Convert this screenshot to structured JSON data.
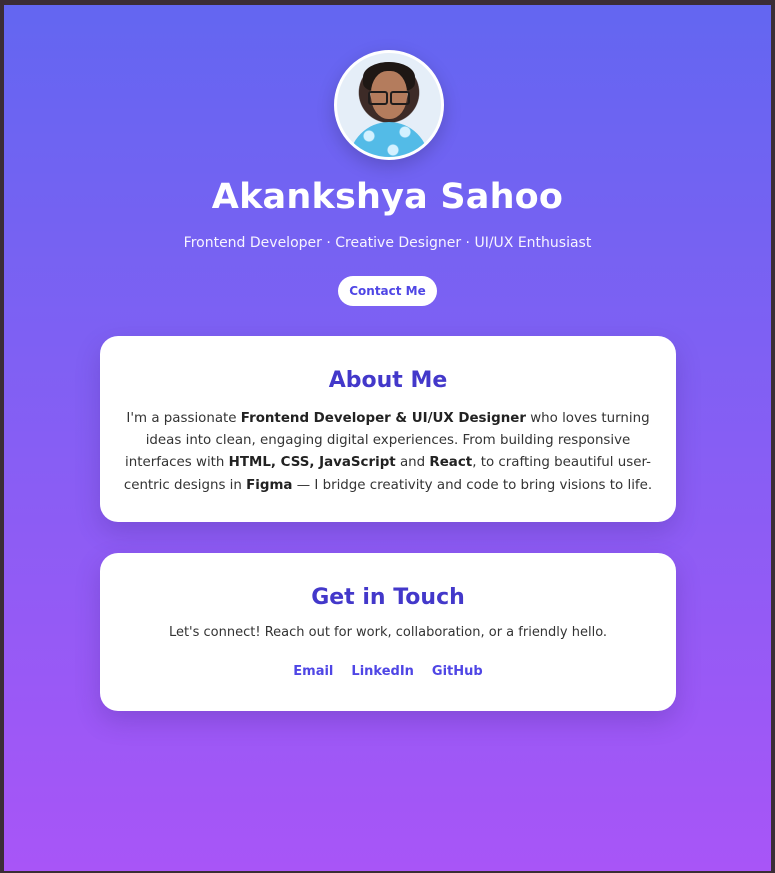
{
  "hero": {
    "name": "Akankshya Sahoo",
    "tagline": "Frontend Developer · Creative Designer · UI/UX Enthusiast",
    "contact_button": "Contact Me"
  },
  "about": {
    "title": "About Me",
    "text": {
      "part1": "I'm a passionate ",
      "highlight1": "Frontend Developer & UI/UX Designer",
      "part2": " who loves turning ideas into clean, engaging digital experiences. From building responsive interfaces with ",
      "highlight2": "HTML, CSS, JavaScript",
      "part3": " and ",
      "highlight3": "React",
      "part4": ", to crafting beautiful user-centric designs in ",
      "highlight4": "Figma",
      "part5": " — I bridge creativity and code to bring visions to life."
    }
  },
  "touch": {
    "title": "Get in Touch",
    "text": "Let's connect! Reach out for work, collaboration, or a friendly hello.",
    "links": [
      "Email",
      "LinkedIn",
      "GitHub"
    ]
  },
  "colors": {
    "gradient_top": "#6366f1",
    "gradient_bottom": "#a855f7",
    "accent": "#4f46e5",
    "heading": "#4338ca",
    "card": "#ffffff"
  }
}
